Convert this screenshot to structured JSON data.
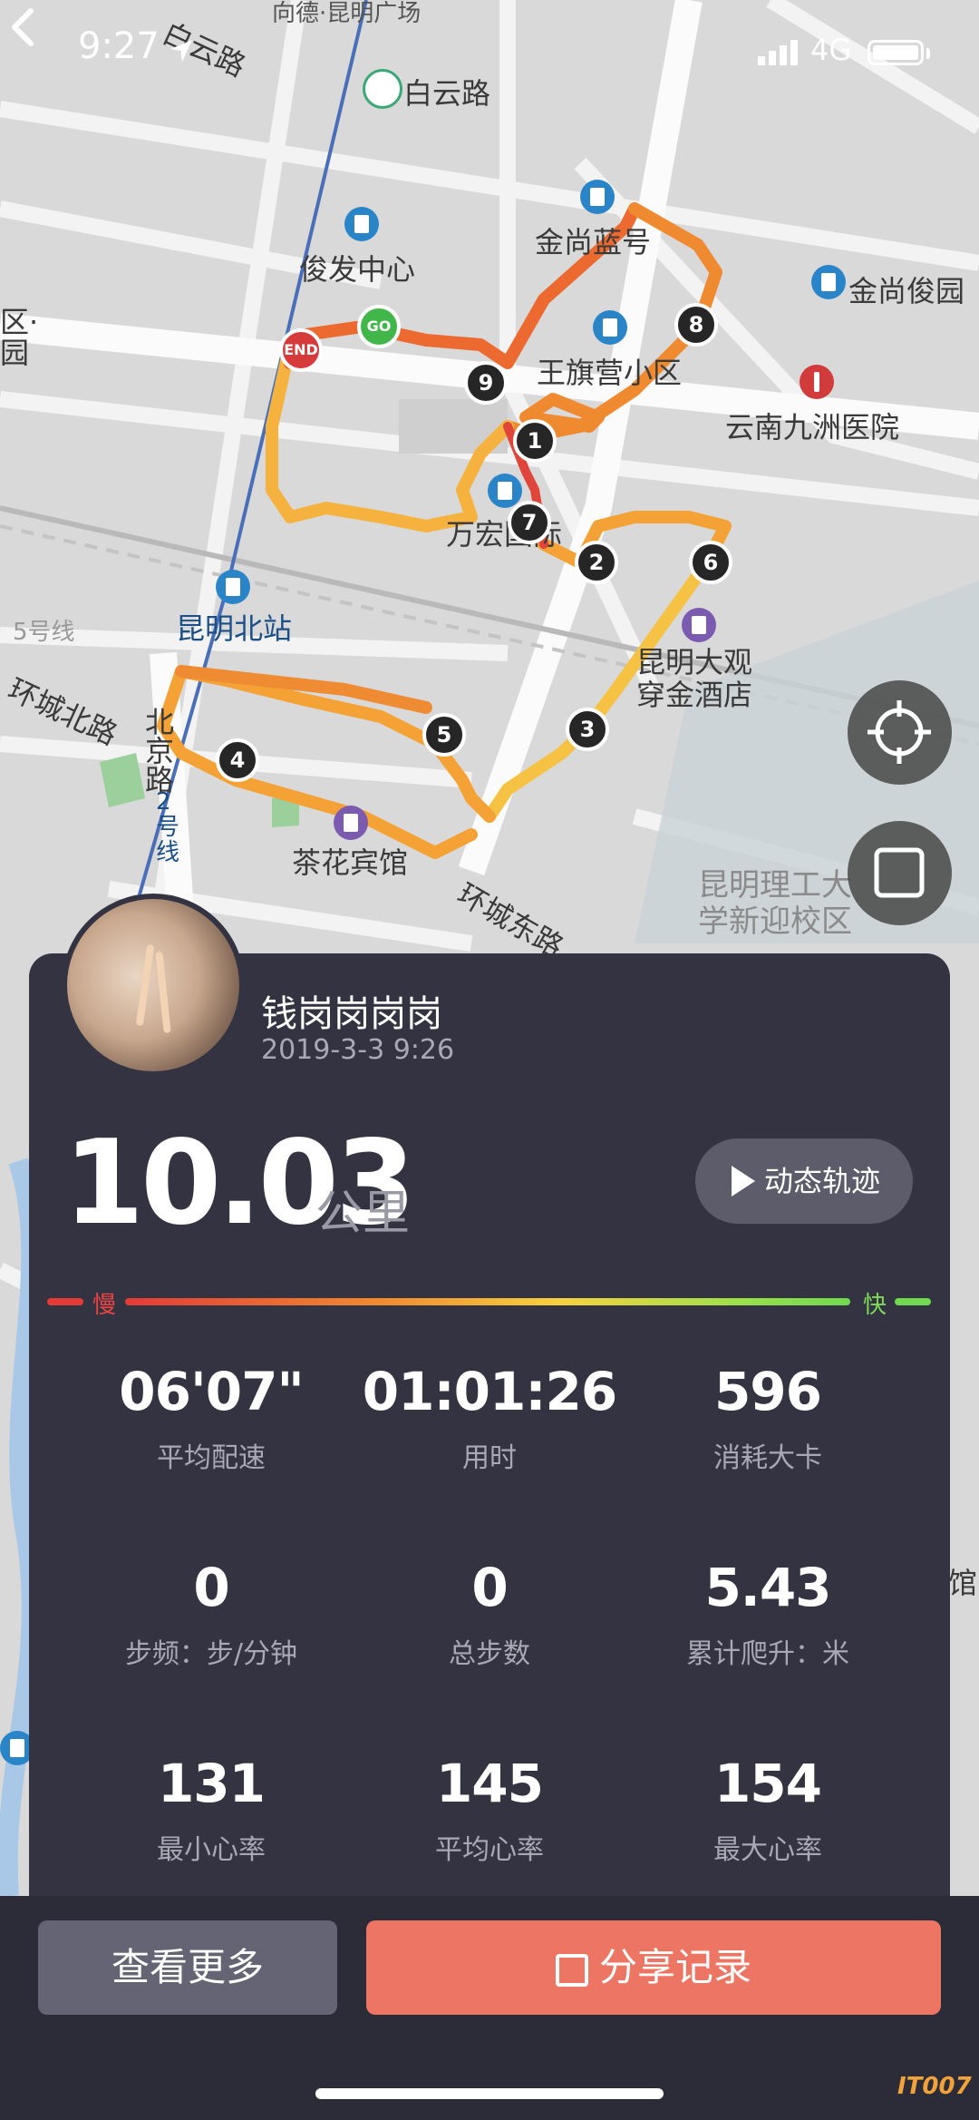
{
  "status_bar": {
    "time": "9:27",
    "network": "4G"
  },
  "map": {
    "labels": {
      "baiyun_road_top": "白云路",
      "baiyun_road": "白云路",
      "top_partial": "向德·昆明广场",
      "junfa": "俊发中心",
      "jinshang_tower": "金尚蓝号",
      "jinshang_garden": "金尚俊园",
      "wangqiying": "王旗营小区",
      "hospital": "云南九洲医院",
      "wanhong": "万宏国际",
      "kunming_north": "昆明北站",
      "line5": "5号线",
      "huancheng_north": "环城北路",
      "beijing_road": "北京路",
      "line2": "2号线",
      "hotel_daguan": "昆明大观穿金酒店",
      "chahua": "茶花宾馆",
      "huancheng_east": "环城东路",
      "kust": "昆明理工大学新迎校区",
      "left_edge_top": "区·",
      "left_edge_top2": "园",
      "right_edge": "馆"
    },
    "markers": [
      "1",
      "2",
      "3",
      "4",
      "5",
      "6",
      "7",
      "8",
      "9"
    ],
    "start_label": "GO",
    "end_label": "END"
  },
  "profile": {
    "username": "钱岗岗岗岗",
    "datetime": "2019-3-3 9:26"
  },
  "summary": {
    "distance": "10.03",
    "unit": "公里",
    "replay_label": "动态轨迹"
  },
  "speed_legend": {
    "slow": "慢",
    "fast": "快"
  },
  "stats": [
    {
      "value": "06'07\"",
      "label": "平均配速"
    },
    {
      "value": "01:01:26",
      "label": "用时"
    },
    {
      "value": "596",
      "label": "消耗大卡"
    },
    {
      "value": "0",
      "label": "步频：步/分钟"
    },
    {
      "value": "0",
      "label": "总步数"
    },
    {
      "value": "5.43",
      "label": "累计爬升：米"
    },
    {
      "value": "131",
      "label": "最小心率"
    },
    {
      "value": "145",
      "label": "平均心率"
    },
    {
      "value": "154",
      "label": "最大心率"
    }
  ],
  "actions": {
    "more": "查看更多",
    "share": "分享记录"
  },
  "watermark": "IT007",
  "colors": {
    "accent": "#ec7563",
    "card": "#343342",
    "track_orange": "#f08a30",
    "track_yellow": "#f6c244"
  }
}
